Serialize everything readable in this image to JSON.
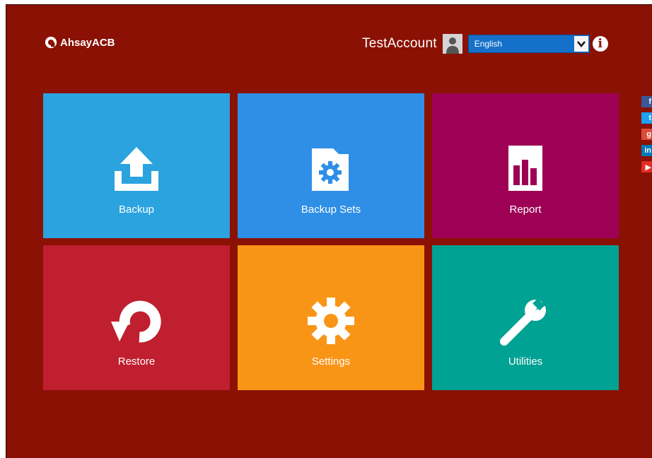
{
  "header": {
    "logo_text": "AhsayACB",
    "account_name": "TestAccount",
    "language": "English"
  },
  "tiles": [
    {
      "label": "Backup",
      "icon": "upload-icon",
      "color": "#2aa3de"
    },
    {
      "label": "Backup Sets",
      "icon": "folder-gear-icon",
      "color": "#2f8fe6"
    },
    {
      "label": "Report",
      "icon": "bar-chart-icon",
      "color": "#9e0055"
    },
    {
      "label": "Restore",
      "icon": "restore-arrow-icon",
      "color": "#bf1f2e"
    },
    {
      "label": "Settings",
      "icon": "gear-icon",
      "color": "#f99516"
    },
    {
      "label": "Utilities",
      "icon": "wrench-icon",
      "color": "#00a293"
    }
  ],
  "social": [
    "facebook-icon",
    "twitter-icon",
    "google-plus-icon",
    "linkedin-icon",
    "youtube-icon"
  ],
  "colors": {
    "background": "#8a1104"
  }
}
